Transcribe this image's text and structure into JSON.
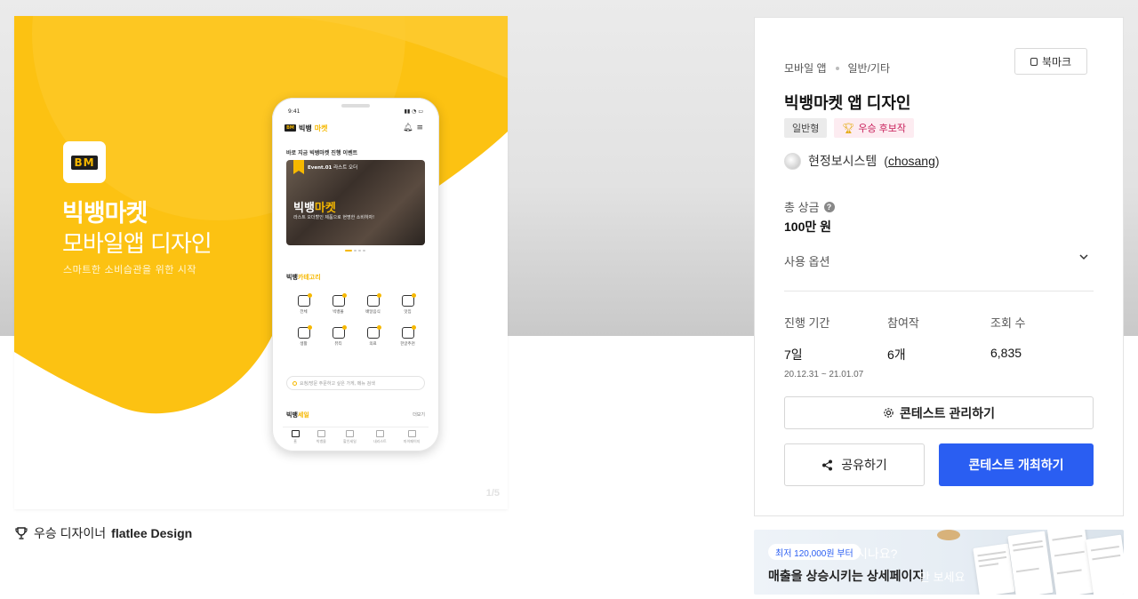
{
  "hero": {
    "logo_text": "BM",
    "title": "빅뱅마켓",
    "subtitle": "모바일앱 디자인",
    "tagline": "스마트한 소비습관을 위한 시작",
    "watermark": "1/5",
    "colors": {
      "yellow": "#f6b800",
      "yellow_light": "#fcc721"
    },
    "phone": {
      "time": "9:41",
      "brand_black": "빅뱅",
      "brand_yellow": "마켓",
      "header_icons": "bell-icon menu-icon",
      "event_heading": "바로 지금 빅뱅마켓 진행 이벤트",
      "banner_event": "Event.01",
      "banner_event_sub": "라스트 오더",
      "banner_big_black": "빅뱅",
      "banner_big_yellow": "마켓",
      "banner_small": "라스트 오더할인 제품으로 현명한 소비하자!",
      "category_black": "빅뱅",
      "category_yellow": "카테고리",
      "categories": [
        "전체",
        "빅뱅몰",
        "배달음식",
        "맛집",
        "생활",
        "뷰티",
        "의료",
        "한글추천"
      ],
      "search_placeholder": "요청/방문 주문하고 싶은 가게, 메뉴 검색",
      "sale_black": "빅뱅",
      "sale_yellow": "세일",
      "more": "더보기",
      "tabs": [
        "홈",
        "빅뱅몰",
        "할인세일",
        "내리스트",
        "마이페이지"
      ]
    }
  },
  "winner": {
    "prefix": "우승 디자이너",
    "name": "flatlee Design"
  },
  "panel": {
    "category": "모바일 앱",
    "subcategory": "일반/기타",
    "bookmark_label": "북마크",
    "title": "빅뱅마켓 앱 디자인",
    "badge_type": "일반형",
    "badge_award": "우승 후보작",
    "host_name": "현정보시스템",
    "host_id": "chosang",
    "prize_label": "총 상금",
    "prize_value": "100만 원",
    "use_option_label": "사용 옵션",
    "stats": [
      {
        "label": "진행 기간",
        "value": "7일",
        "detail": "20.12.31 ~ 21.01.07"
      },
      {
        "label": "참여작",
        "value": "6개",
        "detail": ""
      },
      {
        "label": "조회 수",
        "value": "6,835",
        "detail": ""
      }
    ],
    "manage_label": "콘테스트 관리하기",
    "share_label": "공유하기",
    "host_button_label": "콘테스트 개최하기",
    "accent": "#2a5ef2"
  },
  "ad": {
    "pill": "최저 120,000원 부터",
    "ghost_text": "시나요?",
    "main_text": "매출을 상승시키는 상세페이지",
    "ghost_text2": "만 보세요"
  }
}
